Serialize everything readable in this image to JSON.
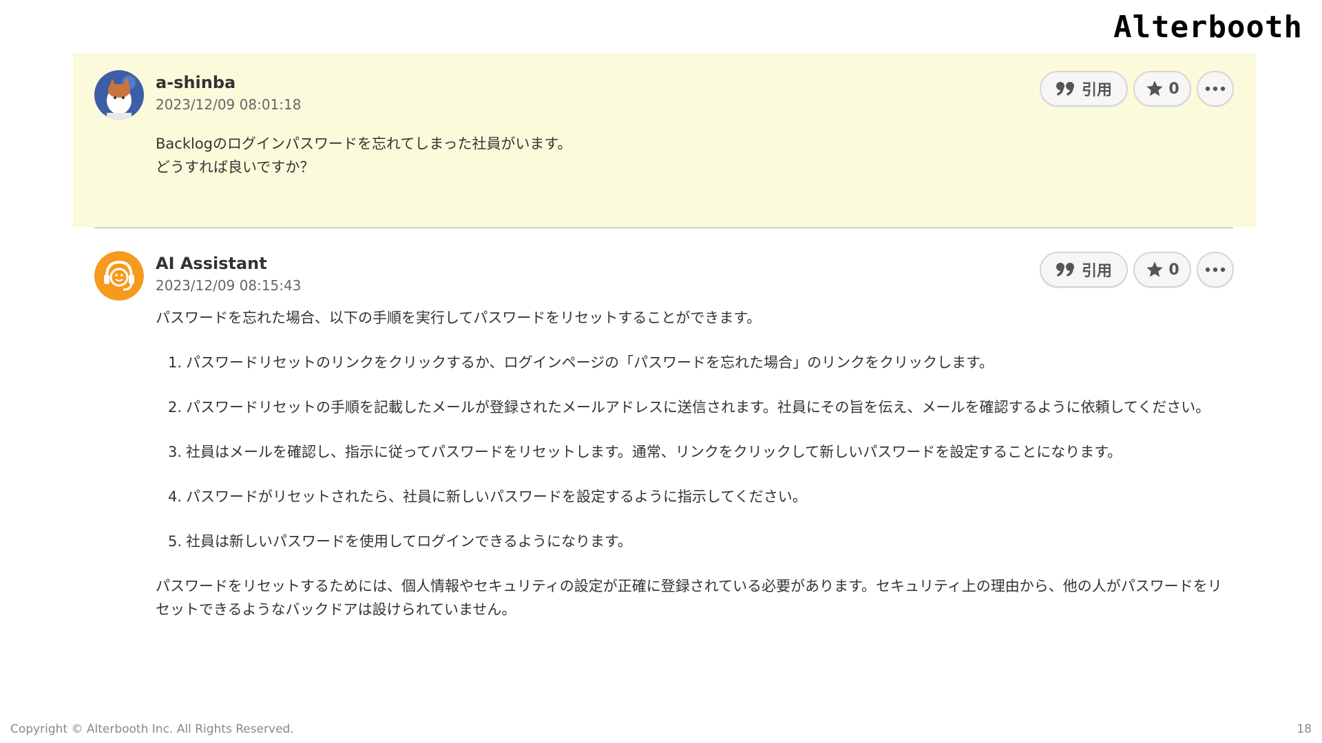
{
  "logo": {
    "text": "Alterbooth"
  },
  "question": {
    "username": "a-shinba",
    "timestamp": "2023/12/09 08:01:18",
    "quote_label": "引用",
    "star_count": "0",
    "lines": [
      "Backlogのログインパスワードを忘れてしまった社員がいます。",
      "どうすれば良いですか？"
    ]
  },
  "answer": {
    "username": "AI Assistant",
    "timestamp": "2023/12/09 08:15:43",
    "quote_label": "引用",
    "star_count": "0",
    "intro": "パスワードを忘れた場合、以下の手順を実行してパスワードをリセットすることができます。",
    "steps": [
      {
        "num": "1.",
        "text": "パスワードリセットのリンクをクリックするか、ログインページの「パスワードを忘れた場合」のリンクをクリックします。"
      },
      {
        "num": "2.",
        "text": "パスワードリセットの手順を記載したメールが登録されたメールアドレスに送信されます。社員にその旨を伝え、メールを確認するように依頼してください。"
      },
      {
        "num": "3.",
        "text": "社員はメールを確認し、指示に従ってパスワードをリセットします。通常、リンクをクリックして新しいパスワードを設定することになります。"
      },
      {
        "num": "4.",
        "text": "パスワードがリセットされたら、社員に新しいパスワードを設定するように指示してください。"
      },
      {
        "num": "5.",
        "text": "社員は新しいパスワードを使用してログインできるようになります。"
      }
    ],
    "closing": "パスワードをリセットするためには、個人情報やセキュリティの設定が正確に登録されている必要があります。セキュリティ上の理由から、他の人がパスワードをリセットできるようなバックドアは設けられていません。"
  },
  "footer": {
    "copyright": "Copyright © Alterbooth Inc. All Rights Reserved.",
    "page_number": "18"
  },
  "icons": {
    "quote": "quote-icon",
    "star": "star-icon",
    "more": "more-icon",
    "user_avatar": "cat-avatar",
    "assistant_avatar": "assistant-avatar"
  },
  "colors": {
    "question_bg": "#fbfadb",
    "assistant_avatar": "#f59a1e",
    "user_avatar_bg": "#3e5fa8"
  }
}
